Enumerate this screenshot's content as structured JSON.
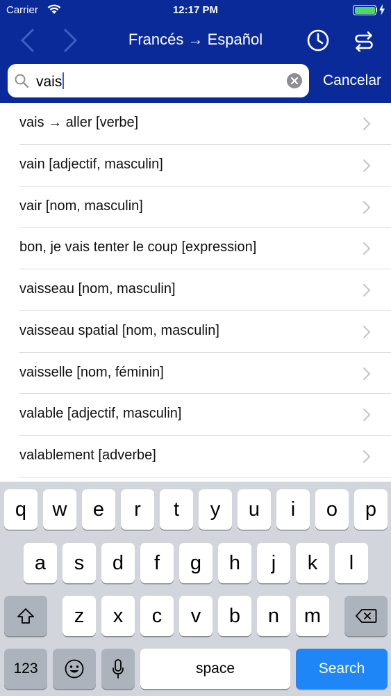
{
  "status_bar": {
    "carrier": "Carrier",
    "time": "12:17 PM",
    "battery_level": 1.0
  },
  "nav": {
    "title": "Francés → Español",
    "icons": [
      "chevron-left-icon",
      "chevron-right-icon",
      "clock-icon",
      "swap-icon"
    ]
  },
  "search": {
    "value": "vais",
    "cancel_label": "Cancelar"
  },
  "results": [
    "vais → aller [verbe]",
    "vain [adjectif, masculin]",
    "vair [nom, masculin]",
    "bon, je vais tenter le coup [expression]",
    "vaisseau [nom, masculin]",
    "vaisseau spatial [nom, masculin]",
    "vaisselle [nom, féminin]",
    "valable [adjectif, masculin]",
    "valablement [adverbe]"
  ],
  "keyboard": {
    "row1": [
      "q",
      "w",
      "e",
      "r",
      "t",
      "y",
      "u",
      "i",
      "o",
      "p"
    ],
    "row2": [
      "a",
      "s",
      "d",
      "f",
      "g",
      "h",
      "j",
      "k",
      "l"
    ],
    "row3": [
      "z",
      "x",
      "c",
      "v",
      "b",
      "n",
      "m"
    ],
    "numbers_label": "123",
    "space_label": "space",
    "search_label": "Search"
  },
  "colors": {
    "header_bg": "#0b2a9a",
    "keyboard_bg": "#d2d5db",
    "search_key": "#1f86f8",
    "battery": "#4cd964"
  }
}
